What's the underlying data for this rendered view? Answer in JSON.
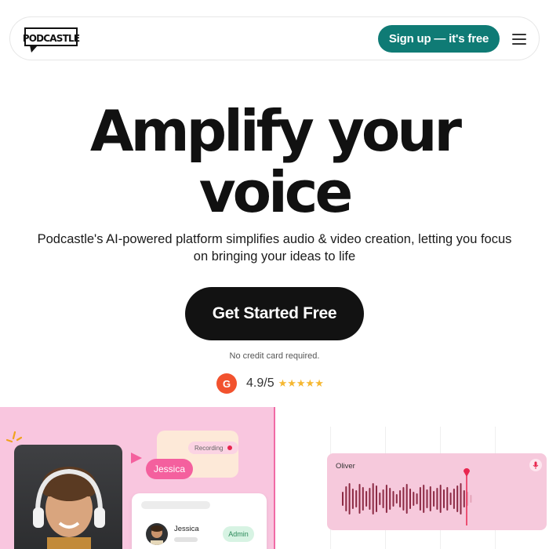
{
  "header": {
    "logo_text": "PODCASTLE",
    "signup_label": "Sign up — it's free",
    "menu_icon": "hamburger-menu-icon"
  },
  "hero": {
    "title_line1": "Amplify your",
    "title_line2": "voice",
    "subtitle_line1": "Podcastle's AI-powered platform simplifies audio & video creation, letting you focus",
    "subtitle_line2": "on bringing your ideas to life",
    "cta_label": "Get Started Free",
    "note": "No credit card required."
  },
  "rating": {
    "badge": "G",
    "score": "4.9/5",
    "stars": "★★★★★",
    "star_count": 5
  },
  "demo": {
    "recording_label": "Recording",
    "speaker_tag": "Jessica",
    "user_name": "Jessica",
    "user_role": "Admin",
    "track_name": "Oliver"
  },
  "colors": {
    "brand_teal": "#0f7b75",
    "cta_black": "#121212",
    "star_gold": "#f5b731",
    "g2_red": "#f2522e",
    "panel_pink": "#f9c6df",
    "accent_pink": "#f4609e",
    "wave_maroon": "#8c2a44"
  }
}
